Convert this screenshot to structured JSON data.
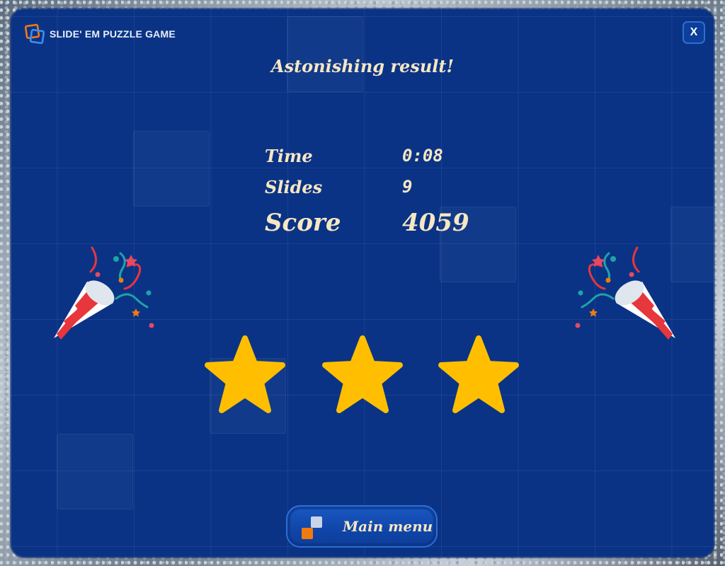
{
  "app": {
    "title": "SLIDE' EM PUZZLE GAME",
    "close_label": "X"
  },
  "result": {
    "headline": "Astonishing result!",
    "stats": {
      "time_label": "Time",
      "time_value": "0:08",
      "slides_label": "Slides",
      "slides_value": "9",
      "score_label": "Score",
      "score_value": "4059"
    },
    "stars_earned": 3,
    "stars_total": 3
  },
  "footer": {
    "main_menu_label": "Main menu"
  },
  "colors": {
    "panel": "#0a3386",
    "text": "#f6e7c2",
    "star": "#ffbf00",
    "accent_orange": "#f07a12",
    "button_border": "#2b6fd6"
  },
  "icons": {
    "logo": "two-overlapping-squares-icon",
    "close": "close-icon",
    "popper": "party-popper-icon",
    "star": "star-icon",
    "menu": "tiles-icon"
  }
}
